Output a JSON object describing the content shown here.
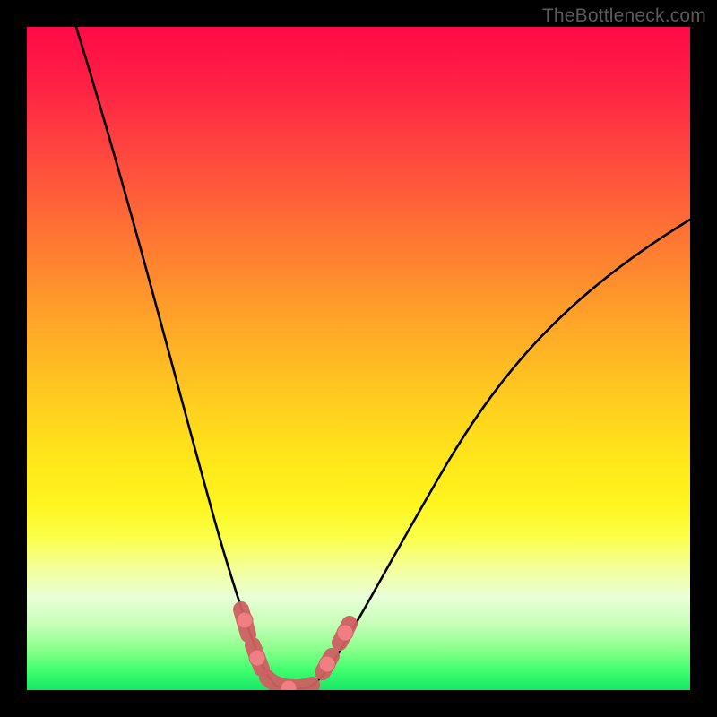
{
  "watermark": "TheBottleneck.com",
  "chart_data": {
    "type": "line",
    "title": "",
    "xlabel": "",
    "ylabel": "",
    "xlim": [
      0,
      100
    ],
    "ylim": [
      0,
      100
    ],
    "x": [
      0,
      5,
      10,
      15,
      20,
      25,
      28,
      30,
      32,
      34,
      36,
      38,
      40,
      45,
      50,
      55,
      60,
      65,
      70,
      75,
      80,
      85,
      90,
      95,
      100
    ],
    "bottleneck_pct": [
      100,
      86,
      72,
      58,
      44,
      30,
      20,
      12,
      6,
      2,
      0,
      0,
      2,
      8,
      17,
      26,
      34,
      41,
      47,
      52,
      57,
      61,
      64,
      67,
      69
    ],
    "notes": "V-shaped bottleneck curve; minimum (~0%) occurs around x≈35–38%; left branch approaches 100% at x=0; right branch rises to ~69% at x=100. Pink marker segments highlight near-bottom region on both branches."
  },
  "colors": {
    "curve": "#000000",
    "marker": "#ef7f82",
    "marker_stroke": "#ce6062"
  }
}
